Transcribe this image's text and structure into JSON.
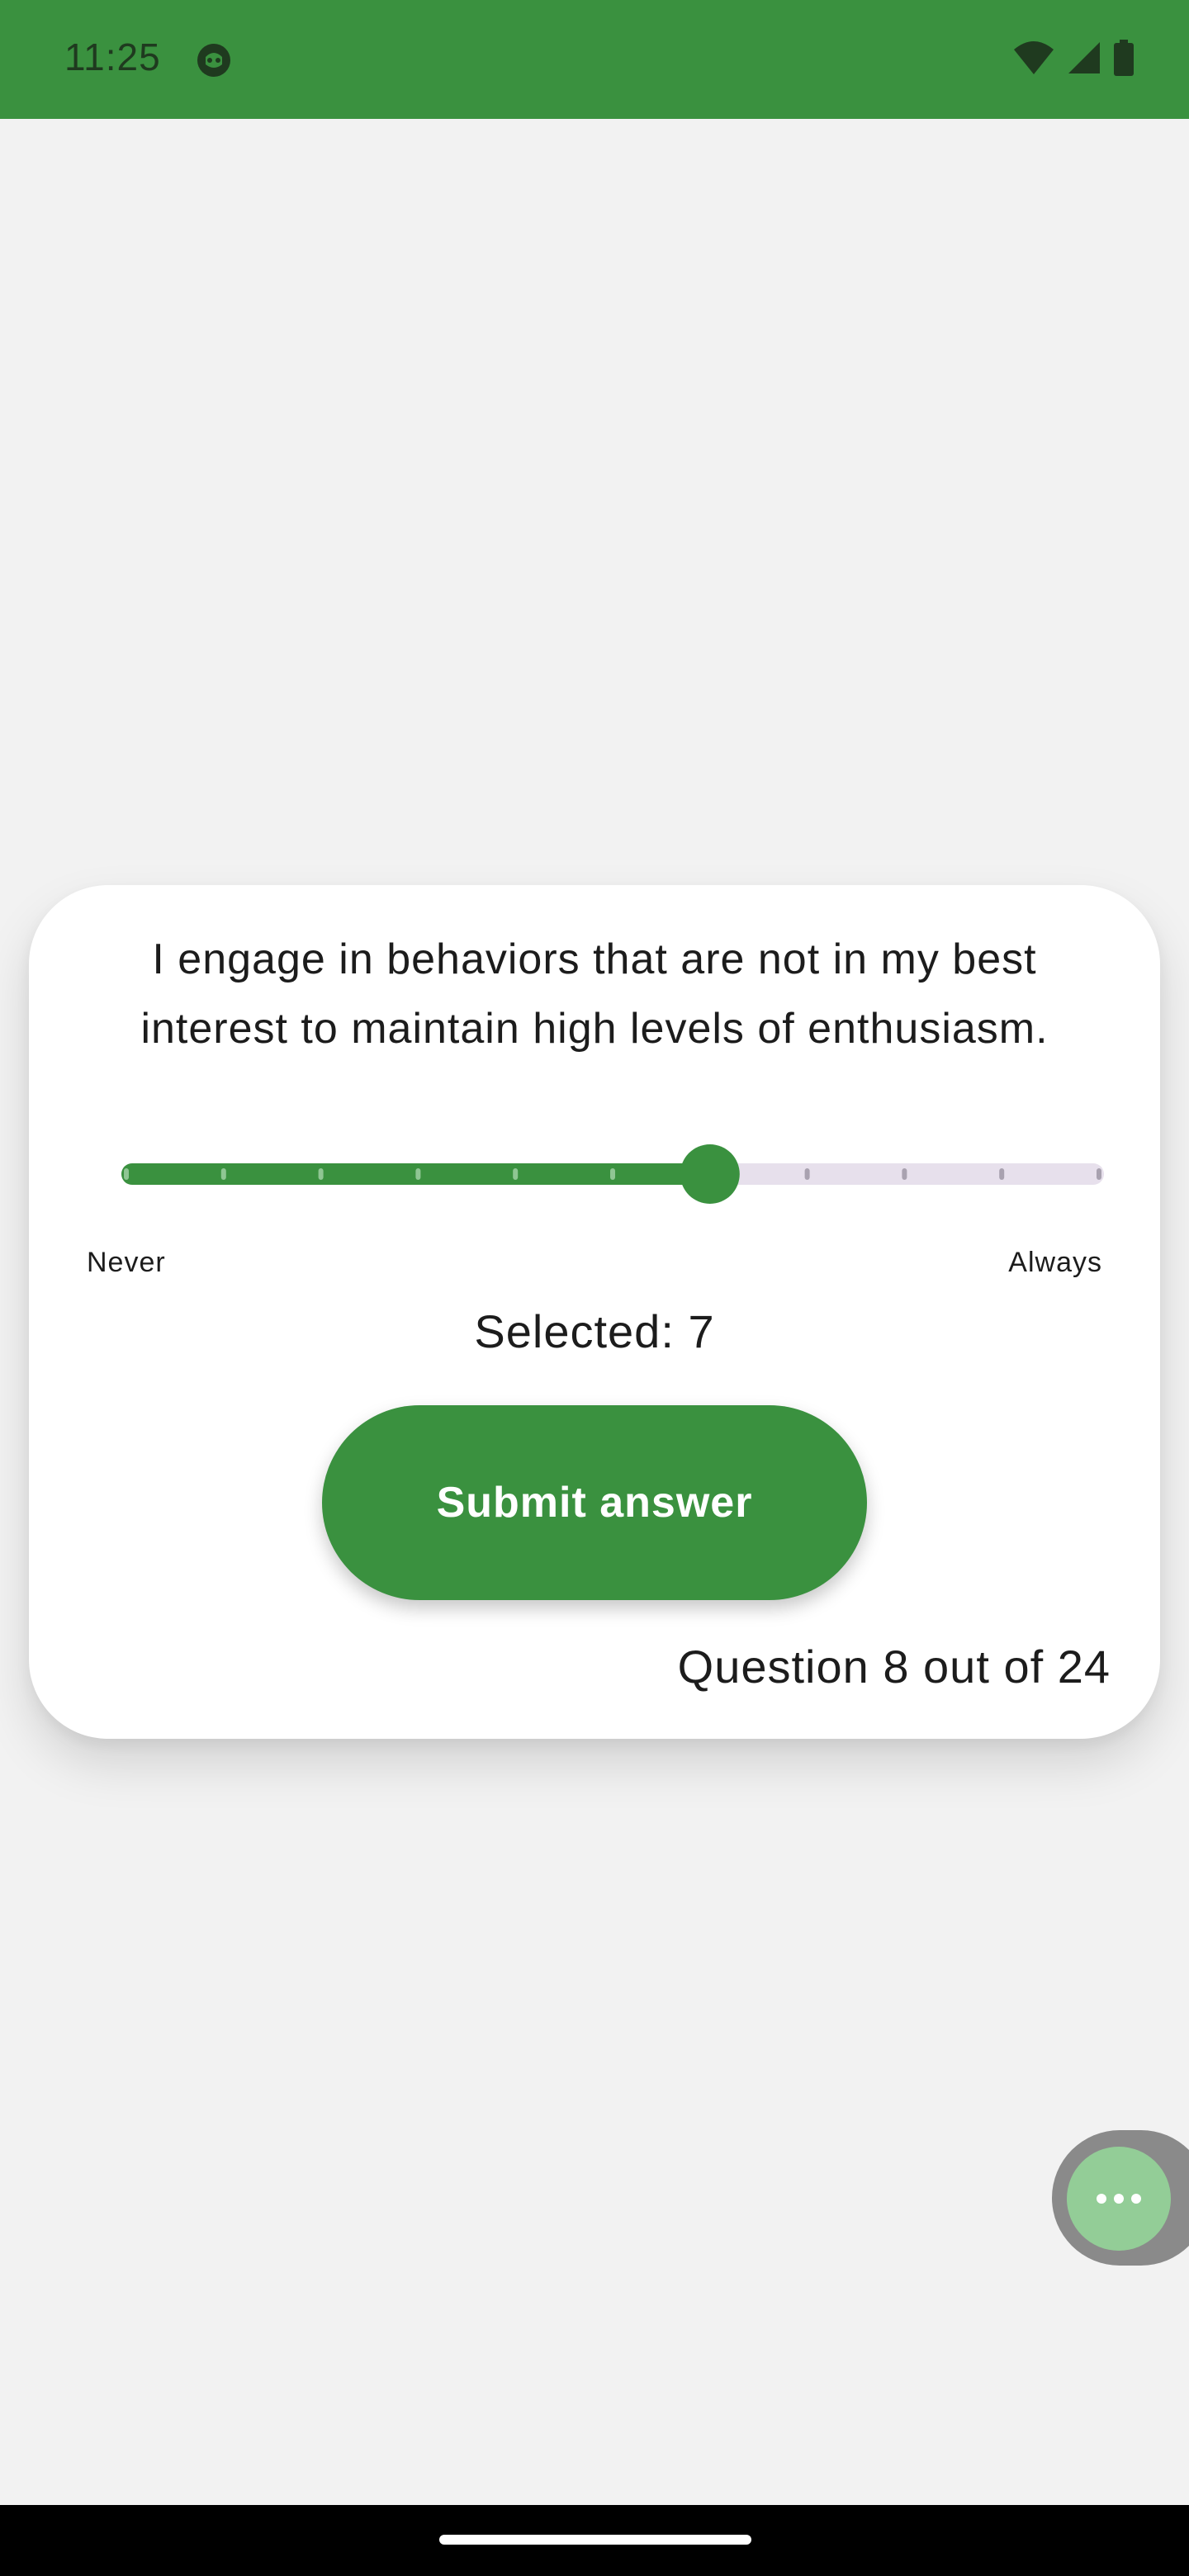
{
  "status_bar": {
    "time": "11:25",
    "background_color": "#3a913f",
    "icons": [
      "app-notification-icon",
      "wifi-icon",
      "cell-signal-icon",
      "battery-icon"
    ]
  },
  "question": {
    "text": "I engage in behaviors that are not in my best interest to maintain high levels of enthusiasm."
  },
  "slider": {
    "min": 1,
    "max": 11,
    "value": 7,
    "min_label": "Never",
    "max_label": "Always",
    "active_color": "#3a913f",
    "inactive_color": "#e7e0ec"
  },
  "selected": {
    "text": "Selected: 7"
  },
  "submit": {
    "label": "Submit answer",
    "color": "#3a913f"
  },
  "progress": {
    "text": "Question 8 out of 24",
    "current": 8,
    "total": 24
  },
  "fab": {
    "icon": "more-dots-icon",
    "color": "#93cd97"
  }
}
